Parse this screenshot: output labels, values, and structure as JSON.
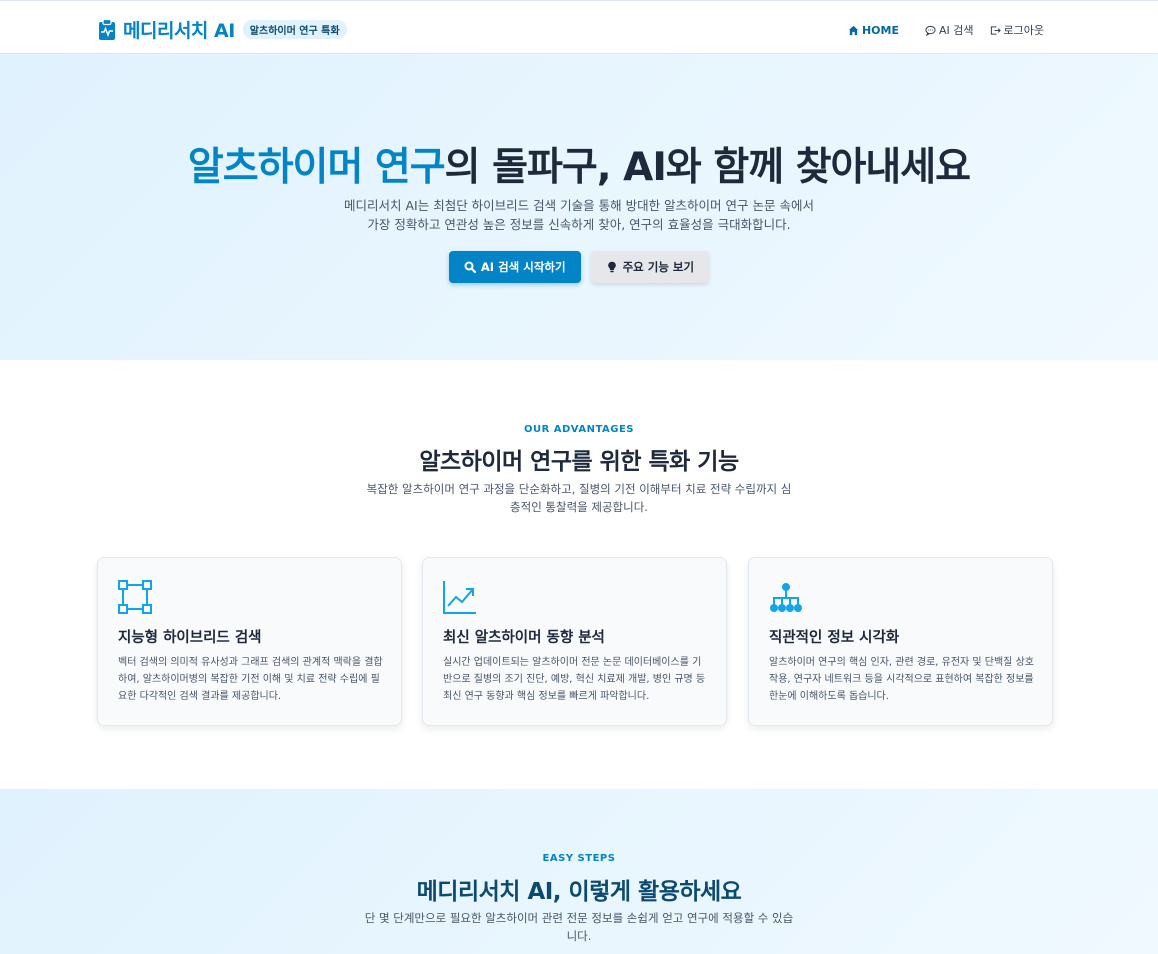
{
  "header": {
    "brand": "메디리서치 AI",
    "badge": "알츠하이머 연구 특화",
    "nav": [
      {
        "label": "HOME",
        "icon": "home-icon",
        "active": true
      },
      {
        "label": "AI 검색",
        "icon": "chat-icon",
        "active": false
      },
      {
        "label": "로그아웃",
        "icon": "logout-icon",
        "active": false
      }
    ]
  },
  "hero": {
    "title_accent": "알츠하이머 연구",
    "title_rest": "의 돌파구, AI와 함께 찾아내세요",
    "subtitle_line1": "메디리서치 AI는 최첨단 하이브리드 검색 기술을 통해 방대한 알츠하이머 연구 논문 속에서",
    "subtitle_line2": "가장 정확하고 연관성 높은 정보를 신속하게 찾아, 연구의 효율성을 극대화합니다.",
    "primary_button": "AI 검색 시작하기",
    "secondary_button": "주요 기능 보기"
  },
  "features": {
    "eyebrow": "OUR ADVANTAGES",
    "title": "알츠하이머 연구를 위한 특화 기능",
    "desc_line1": "복잡한 알츠하이머 연구 과정을 단순화하고, 질병의 기전 이해부터 치료 전략 수립까지 심",
    "desc_line2": "층적인 통찰력을 제공합니다.",
    "cards": [
      {
        "icon": "network-nodes-icon",
        "title": "지능형 하이브리드 검색",
        "desc": "벡터 검색의 의미적 유사성과 그래프 검색의 관계적 맥락을 결합하여, 알츠하이머병의 복잡한 기전 이해 및 치료 전략 수립에 필요한 다각적인 검색 결과를 제공합니다."
      },
      {
        "icon": "trend-chart-icon",
        "title": "최신 알츠하이머 동향 분석",
        "desc": "실시간 업데이트되는 알츠하이머 전문 논문 데이터베이스를 기반으로 질병의 조기 진단, 예방, 혁신 치료제 개발, 병인 규명 등 최신 연구 동향과 핵심 정보를 빠르게 파악합니다."
      },
      {
        "icon": "hierarchy-icon",
        "title": "직관적인 정보 시각화",
        "desc": "알츠하이머 연구의 핵심 인자, 관련 경로, 유전자 및 단백질 상호작용, 연구자 네트워크 등을 시각적으로 표현하여 복잡한 정보를 한눈에 이해하도록 돕습니다."
      }
    ]
  },
  "steps": {
    "eyebrow": "EASY STEPS",
    "title": "메디리서치 AI, 이렇게 활용하세요",
    "desc_line1": "단 몇 단계만으로 필요한 알츠하이머 관련 전문 정보를 손쉽게 얻고 연구에 적용할 수 있습",
    "desc_line2": "니다."
  },
  "colors": {
    "accent": "#0284c7",
    "hero_bg": "#e0f2fe",
    "text_dark": "#1e293b",
    "text_muted": "#475569"
  }
}
